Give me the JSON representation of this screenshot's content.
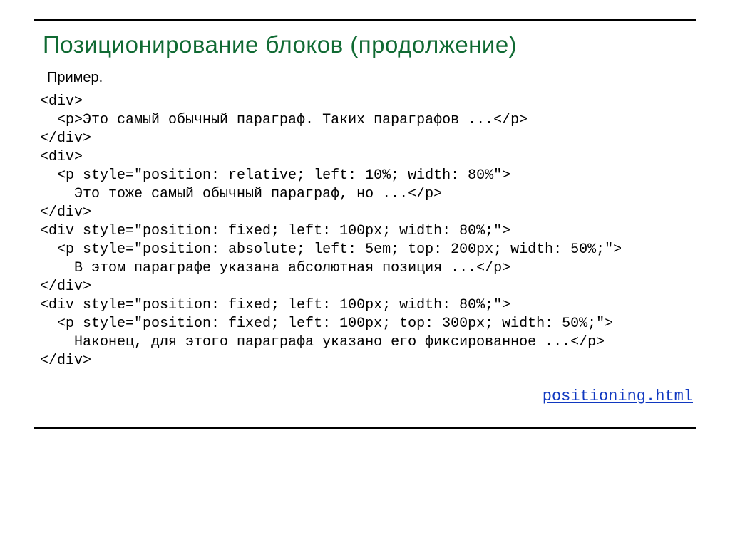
{
  "title": "Позиционирование блоков (продолжение)",
  "example_label": "Пример.",
  "code": "<div>\n  <p>Это самый обычный параграф. Таких параграфов ...</p>\n</div>\n<div>\n  <p style=\"position: relative; left: 10%; width: 80%\">\n    Это тоже самый обычный параграф, но ...</p>\n</div>\n<div style=\"position: fixed; left: 100px; width: 80%;\">\n  <p style=\"position: absolute; left: 5em; top: 200px; width: 50%;\">\n    В этом параграфе указана абсолютная позиция ...</p>\n</div>\n<div style=\"position: fixed; left: 100px; width: 80%;\">\n  <p style=\"position: fixed; left: 100px; top: 300px; width: 50%;\">\n    Наконец, для этого параграфа указано его фиксированное ...</p>\n</div>",
  "link": "positioning.html"
}
